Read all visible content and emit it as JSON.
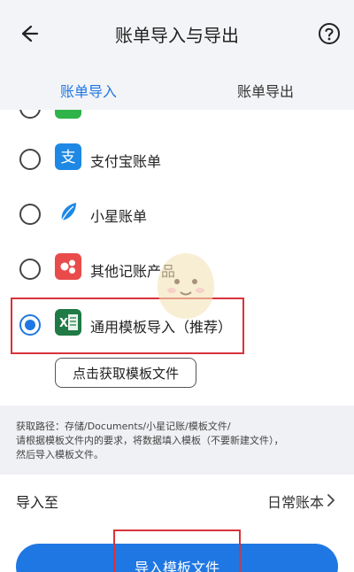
{
  "header": {
    "title": "账单导入与导出"
  },
  "tabs": [
    {
      "label": "账单导入"
    },
    {
      "label": "账单导出"
    }
  ],
  "options": [
    {
      "label": "支付宝账单"
    },
    {
      "label": "小星账单"
    },
    {
      "label": "其他记账产品"
    },
    {
      "label": "通用模板导入（推荐）"
    }
  ],
  "template_button": {
    "label": "点击获取模板文件"
  },
  "info": {
    "line1": "获取路径：存储/Documents/小星记账/模板文件/",
    "line2": "请根据模板文件内的要求，将数据填入模板（不要新建文件），",
    "line3": "然后导入模板文件。"
  },
  "import_to": {
    "label": "导入至",
    "value": "日常账本"
  },
  "bottom_button": {
    "label": "导入模板文件"
  },
  "colors": {
    "accent": "#1f77e3",
    "highlight": "#d8333a",
    "alipay": "#1e88e5",
    "excel": "#1f7a45"
  }
}
